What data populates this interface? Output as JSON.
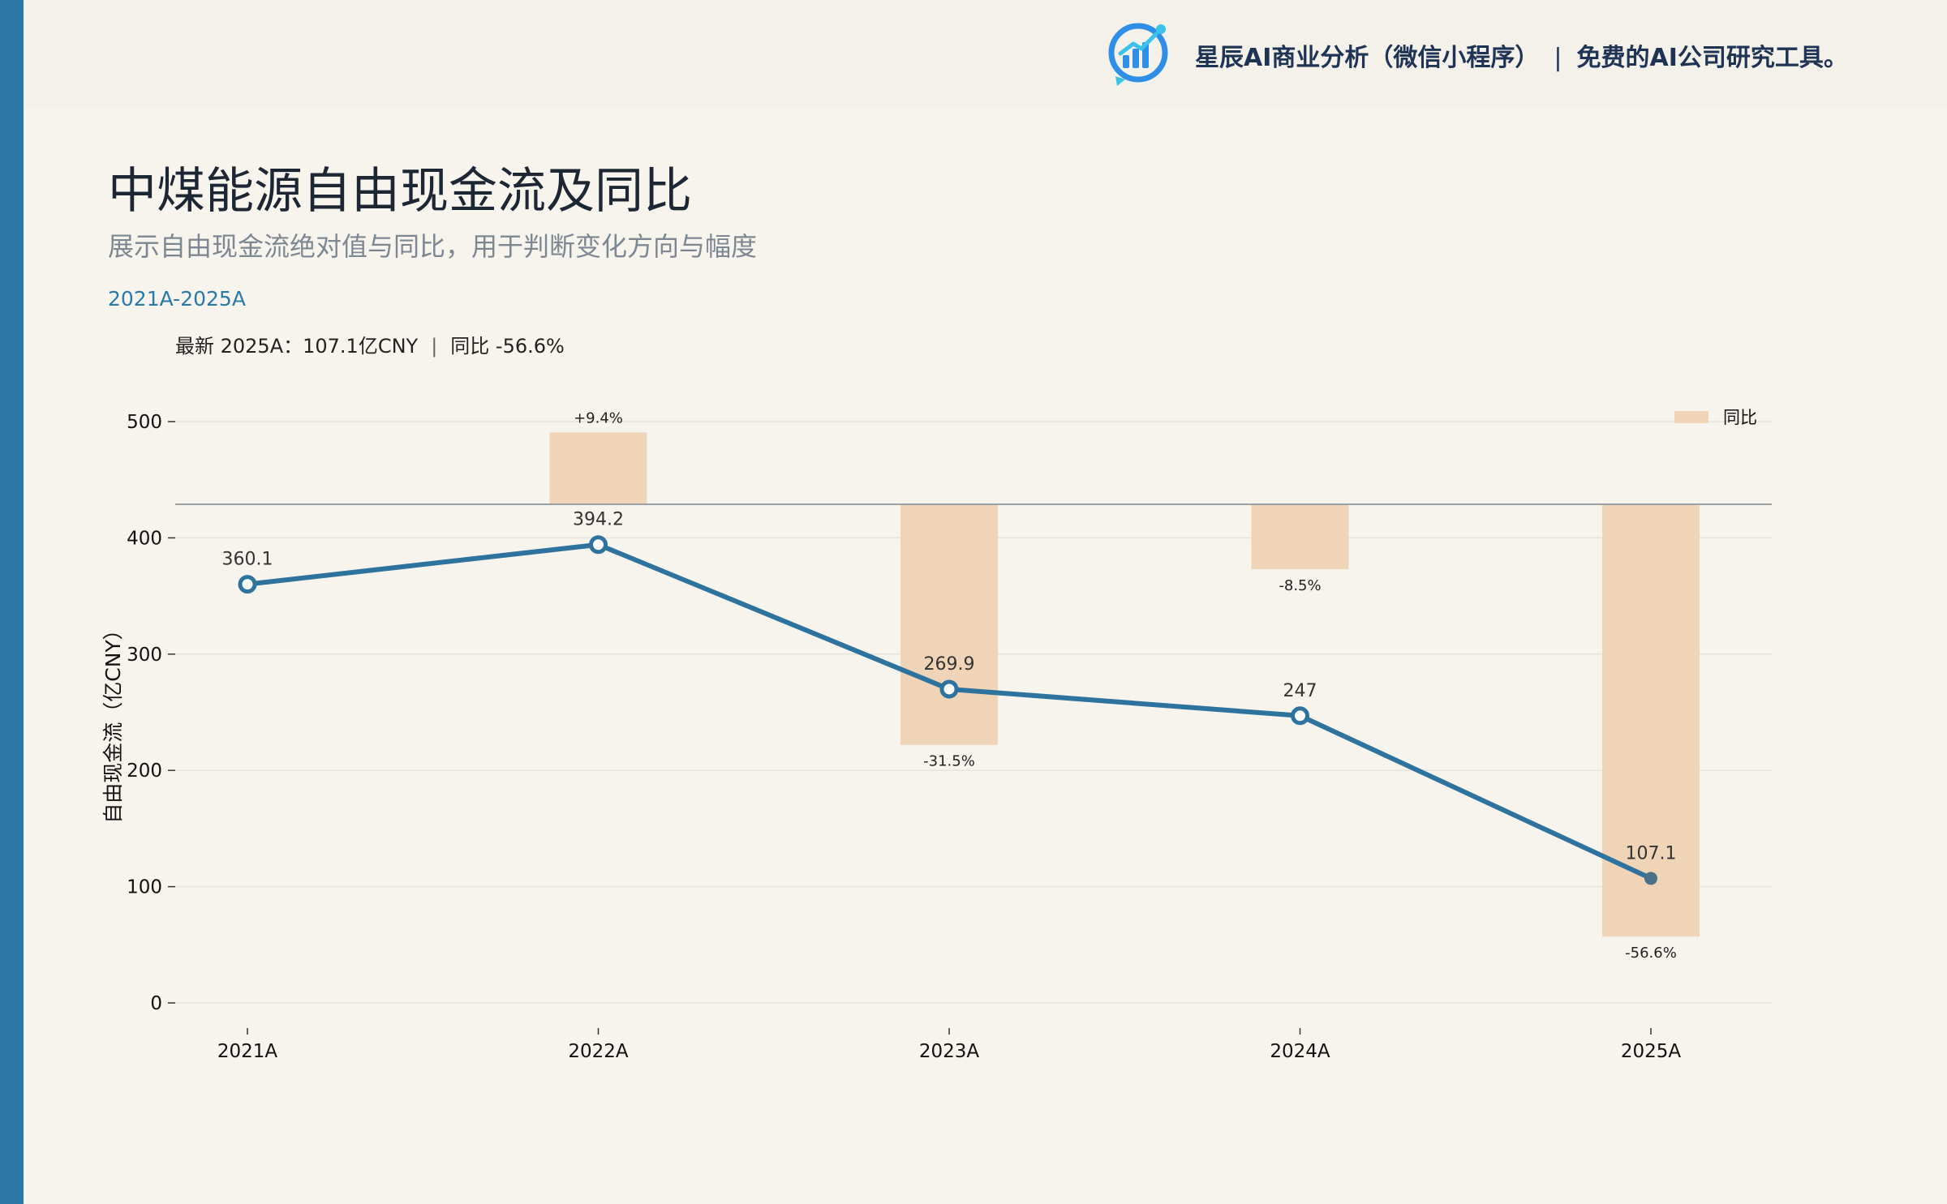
{
  "brand": {
    "name": "星辰AI商业分析（微信小程序）",
    "separator": "|",
    "tagline": "免费的AI公司研究工具。",
    "logo_icon": "bar-chart-logo-icon",
    "colors": {
      "logo": "#2f8fe6",
      "text": "#1f3355"
    }
  },
  "page": {
    "title": "中煤能源自由现金流及同比",
    "subtitle": "展示自由现金流绝对值与同比，用于判断变化方向与幅度",
    "range": "2021A-2025A"
  },
  "latest": {
    "label": "最新 2025A：107.1亿CNY",
    "separator": "|",
    "yoy": "同比 -56.6%"
  },
  "chart_data": {
    "type": "line",
    "categories": [
      "2021A",
      "2022A",
      "2023A",
      "2024A",
      "2025A"
    ],
    "ylabel": "自由现金流（亿CNY）",
    "ylim": [
      0,
      500
    ],
    "yticks": [
      0,
      100,
      200,
      300,
      400,
      500
    ],
    "grid": true,
    "legend": {
      "position": "top-right",
      "entries": [
        "同比"
      ]
    },
    "series": [
      {
        "type": "line",
        "values": [
          360.1,
          394.2,
          269.9,
          247,
          107.1
        ],
        "labels": [
          "360.1",
          "394.2",
          "269.9",
          "247",
          "107.1"
        ],
        "color": "#2e739e"
      },
      {
        "type": "bar",
        "name": "同比",
        "values": [
          null,
          9.4,
          -31.5,
          -8.5,
          -56.6
        ],
        "labels": [
          "",
          "+9.4%",
          "-31.5%",
          "-8.5%",
          "-56.6%"
        ],
        "color": "#efd4b8"
      }
    ]
  },
  "colors": {
    "accent": "#2b78a6",
    "background": "#f7f4ee",
    "header": "#f4f0ea",
    "grid": "#e6e2dc",
    "baseline": "#9aa0a6"
  }
}
